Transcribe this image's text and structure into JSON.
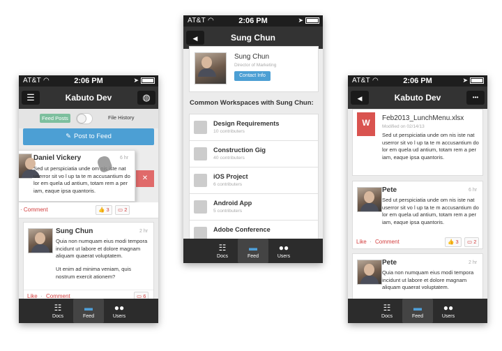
{
  "status": {
    "carrier": "AT&T",
    "time": "2:06 PM"
  },
  "icons": {
    "menu": "☰",
    "globe": "◍",
    "back": "◀",
    "more": "•••",
    "wifi": "◠",
    "location": "➤",
    "post": "✎",
    "thumb": "👍",
    "comment": "💬",
    "docs": "☷",
    "feed": "▬",
    "users": "👥",
    "close": "✕",
    "hand": "☚"
  },
  "tabs": {
    "docs": "Docs",
    "feed": "Feed",
    "users": "Users"
  },
  "left": {
    "nav_title": "Kabuto Dev",
    "toggle_left": "Feed Posts",
    "toggle_right": "File History",
    "post_button": "Post to Feed",
    "post1": {
      "name": "Daniel Vickery",
      "time": "6 hr",
      "text": "Sed ut perspiciatia unde om nis iste nat userror sit vo l up ta te m accusantium do lor em quela ud antium, totam rem a per iam, eaque ipsa quantoris.",
      "comment": "Comment",
      "sep": "·",
      "likes": "3",
      "comments": "2"
    },
    "post2": {
      "name": "Sung Chun",
      "time": "2 hr",
      "text1": "Quia non numquam eius modi tempora incidunt ut labore et dolore magnam aliquam quaerat voluptatem.",
      "text2": "Ut enim ad minima veniam, quis nostrum exercit ationem?",
      "like": "Like",
      "sep": "·",
      "comment": "Comment",
      "comments": "6"
    }
  },
  "middle": {
    "nav_title": "Sung Chun",
    "profile_name": "Sung Chun",
    "profile_role": "Director of Marketing",
    "contact_button": "Contact Info",
    "section_title": "Common Workspaces with Sung Chun:",
    "workspaces": [
      {
        "name": "Design Requirements",
        "sub": "10 contributers"
      },
      {
        "name": "Construction Gig",
        "sub": "40 contributers"
      },
      {
        "name": "iOS Project",
        "sub": "6 contributers"
      },
      {
        "name": "Android App",
        "sub": "5 contributers"
      },
      {
        "name": "Adobe Conference",
        "sub": ""
      }
    ]
  },
  "right": {
    "nav_title": "Kabuto Dev",
    "file": {
      "name": "Feb2013_LunchMenu.xlsx",
      "modified": "Modified on 02/14/13",
      "text": "Sed ut perspiciatia unde om nis iste nat userror sit vo l up ta te m accusantium do lor em quela ud antium, totam rem a per iam, eaque ipsa quantoris."
    },
    "post1": {
      "name": "Pete",
      "time": "6 hr",
      "text": "Sed ut perspiciatia unde om nis iste nat userror sit vo l up ta te m accusantium do lor em quela ud antium, totam rem a per iam, eaque ipsa quantoris.",
      "like": "Like",
      "sep": "·",
      "comment": "Comment",
      "likes": "3",
      "comments": "2"
    },
    "post2": {
      "name": "Pete",
      "time": "2 hr",
      "text": "Quia non numquam eius modi tempora incidunt ut labore et dolore magnam aliquam quaerat voluptatem."
    }
  }
}
